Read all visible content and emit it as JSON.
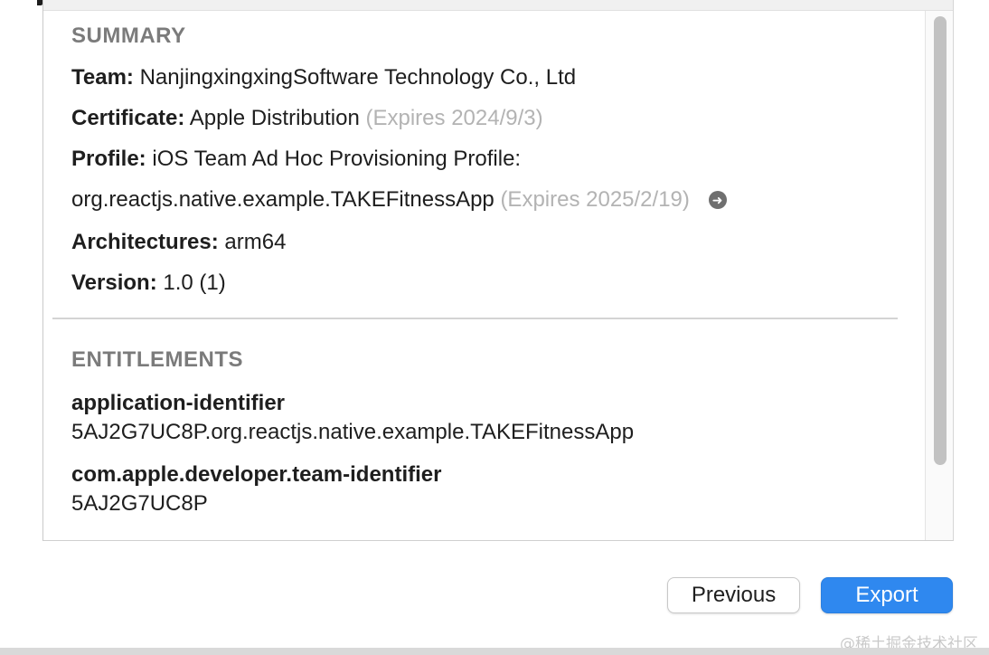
{
  "summary": {
    "title": "SUMMARY",
    "team_key": "Team:",
    "team_value": "NanjingxingxingSoftware Technology Co., Ltd",
    "certificate_key": "Certificate:",
    "certificate_value": "Apple Distribution",
    "certificate_expiry": "(Expires 2024/9/3)",
    "profile_key": "Profile:",
    "profile_value_line1": "iOS Team Ad Hoc Provisioning Profile:",
    "profile_value_line2": "org.reactjs.native.example.TAKEFitnessApp",
    "profile_expiry": "(Expires 2025/2/19)",
    "architectures_key": "Architectures:",
    "architectures_value": "arm64",
    "version_key": "Version:",
    "version_value": "1.0 (1)"
  },
  "entitlements": {
    "title": "ENTITLEMENTS",
    "items": [
      {
        "key": "application-identifier",
        "value": "5AJ2G7UC8P.org.reactjs.native.example.TAKEFitnessApp"
      },
      {
        "key": "com.apple.developer.team-identifier",
        "value": "5AJ2G7UC8P"
      }
    ]
  },
  "footer": {
    "previous_label": "Previous",
    "export_label": "Export"
  },
  "icons": {
    "profile_reveal": "arrow-right-circle-icon"
  },
  "watermark": "@稀土掘金技术社区",
  "colors": {
    "accent": "#2f88ef",
    "section_title": "#7b7b7b",
    "muted": "#b3b3b3"
  }
}
